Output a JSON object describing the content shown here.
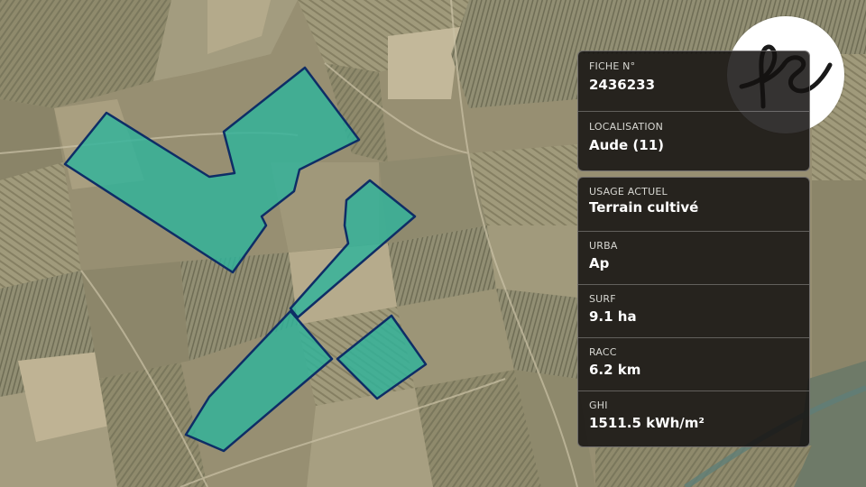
{
  "map": {
    "parcel_fill": "#2fb39b",
    "parcel_stroke": "#0e2d66",
    "parcel_count": 5
  },
  "logo": {
    "text": "fs",
    "icon": "fs-monogram-logo"
  },
  "fiche": {
    "label": "FICHE N°",
    "value": "2436233"
  },
  "localisation": {
    "label": "LOCALISATION",
    "value": "Aude (11)"
  },
  "attributes": [
    {
      "label": "USAGE ACTUEL",
      "value": "Terrain cultivé"
    },
    {
      "label": "URBA",
      "value": "Ap"
    },
    {
      "label": "SURF",
      "value": "9.1 ha"
    },
    {
      "label": "RACC",
      "value": "6.2 km"
    },
    {
      "label": "GHI",
      "value": "1511.5 kWh/m²"
    }
  ]
}
